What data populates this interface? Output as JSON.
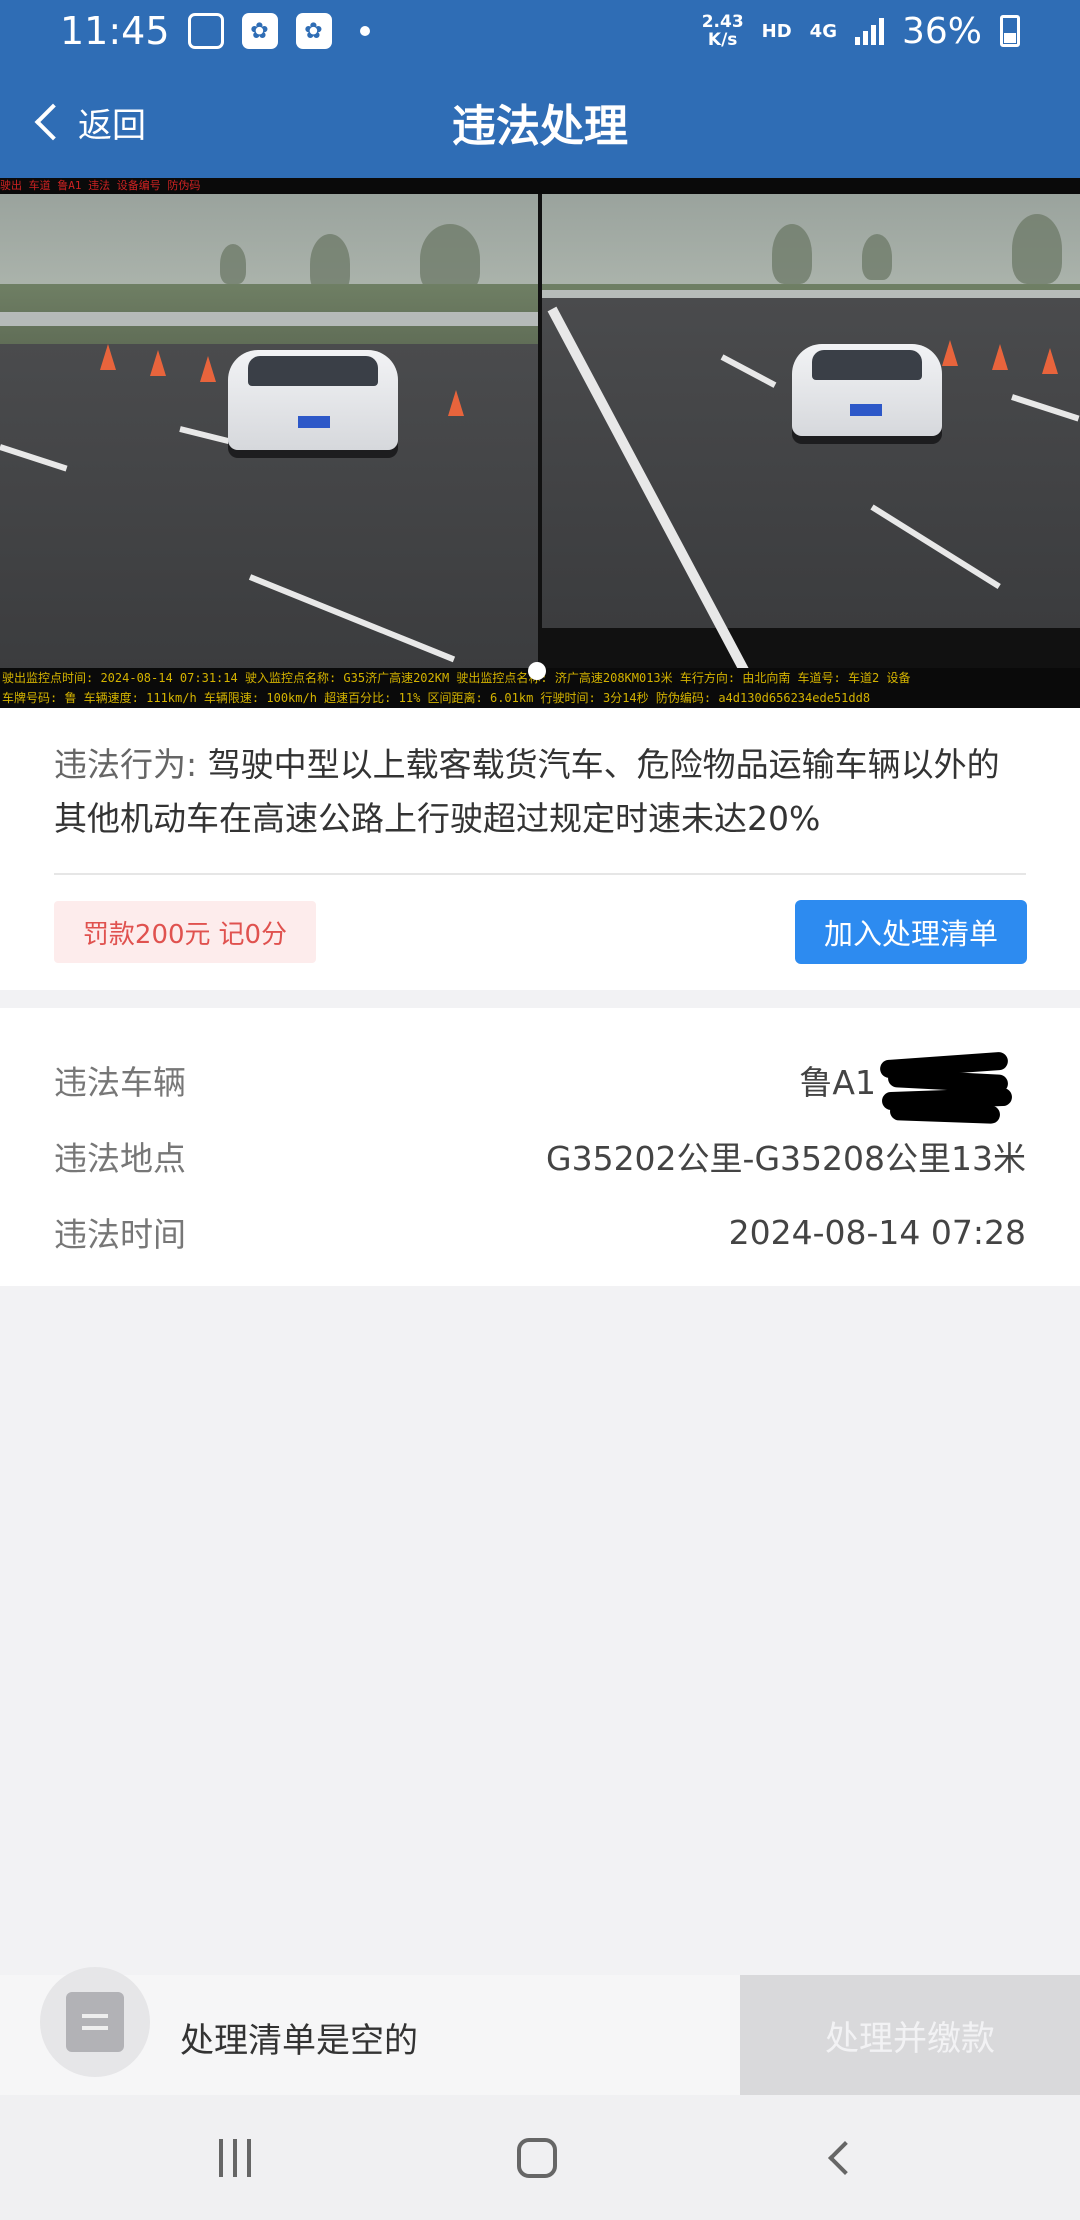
{
  "status_bar": {
    "time": "11:45",
    "net_speed_value": "2.43",
    "net_speed_unit": "K/s",
    "hd": "HD",
    "network": "4G",
    "battery": "36%",
    "icons": [
      "gallery-icon",
      "baidu-paw-icon",
      "baidu-paw-icon",
      "notification-dot",
      "signal-icon",
      "battery-icon"
    ]
  },
  "nav": {
    "back_label": "返回",
    "title": "违法处理"
  },
  "photos": {
    "top_caption": "驶出 车道 鲁A1 违法 设备编号 防伪码",
    "bottom_caption_line1": "驶出监控点时间: 2024-08-14 07:31:14 驶入监控点名称: G35济广高速202KM 驶出监控点名称: 济广高速208KM013米 车行方向: 由北向南 车道号: 车道2 设备",
    "bottom_caption_line2": "车牌号码: 鲁 车辆速度: 111km/h 车辆限速: 100km/h 超速百分比: 11% 区间距离: 6.01km 行驶时间: 3分14秒 防伪编码: a4d130d656234ede51dd8",
    "active_index": 0,
    "count": 1
  },
  "violation": {
    "label": "违法行为:",
    "text": "驾驶中型以上载客载货汽车、危险物品运输车辆以外的其他机动车在高速公路上行驶超过规定时速未达20%",
    "fine": "罚款200元",
    "points": "记0分",
    "add_button": "加入处理清单"
  },
  "details": [
    {
      "label": "违法车辆",
      "value": "鲁A1"
    },
    {
      "label": "违法地点",
      "value": "G35202公里-G35208公里13米"
    },
    {
      "label": "违法时间",
      "value": "2024-08-14 07:28"
    }
  ],
  "action_bar": {
    "cart_status": "处理清单是空的",
    "pay_button": "处理并缴款"
  },
  "colors": {
    "header": "#2f6db5",
    "primary_button": "#2d8bf0",
    "fine_text": "#e0524f",
    "fine_bg": "#fdecec",
    "disabled_button": "#d9d9db"
  }
}
